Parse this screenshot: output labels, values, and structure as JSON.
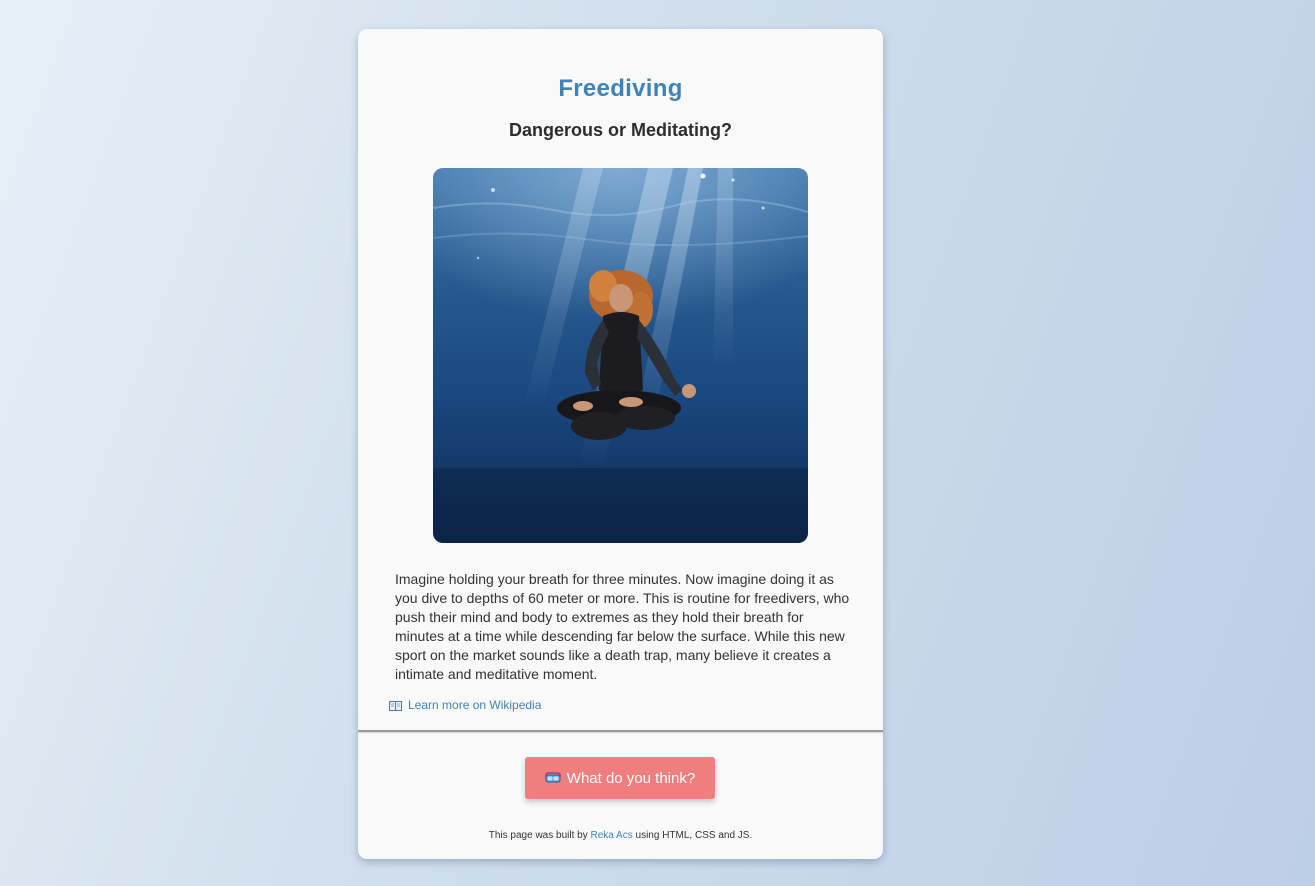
{
  "article": {
    "title": "Freediving",
    "subtitle": "Dangerous or Meditating?",
    "image_alt": "freediver meditating underwater",
    "description": "Imagine holding your breath for three minutes. Now imagine doing it as you dive to depths of 60 meter or more. This is routine for freedivers, who push their mind and body to extremes as they hold their breath for minutes at a time while descending far below the surface. While this new sport on the market sounds like a death trap, many believe it creates a intimate and meditative moment.",
    "wiki_link_label": "Learn more on Wikipedia",
    "wiki_icon": "book-icon"
  },
  "cta": {
    "label": "What do you think?",
    "icon": "diving-mask-icon"
  },
  "footer": {
    "prefix": "This page was built by ",
    "author": "Reka Acs",
    "suffix": " using HTML, CSS and JS."
  },
  "colors": {
    "accent": "#3f83b9",
    "button": "#f07e7e",
    "card": "#f9f9f9"
  }
}
